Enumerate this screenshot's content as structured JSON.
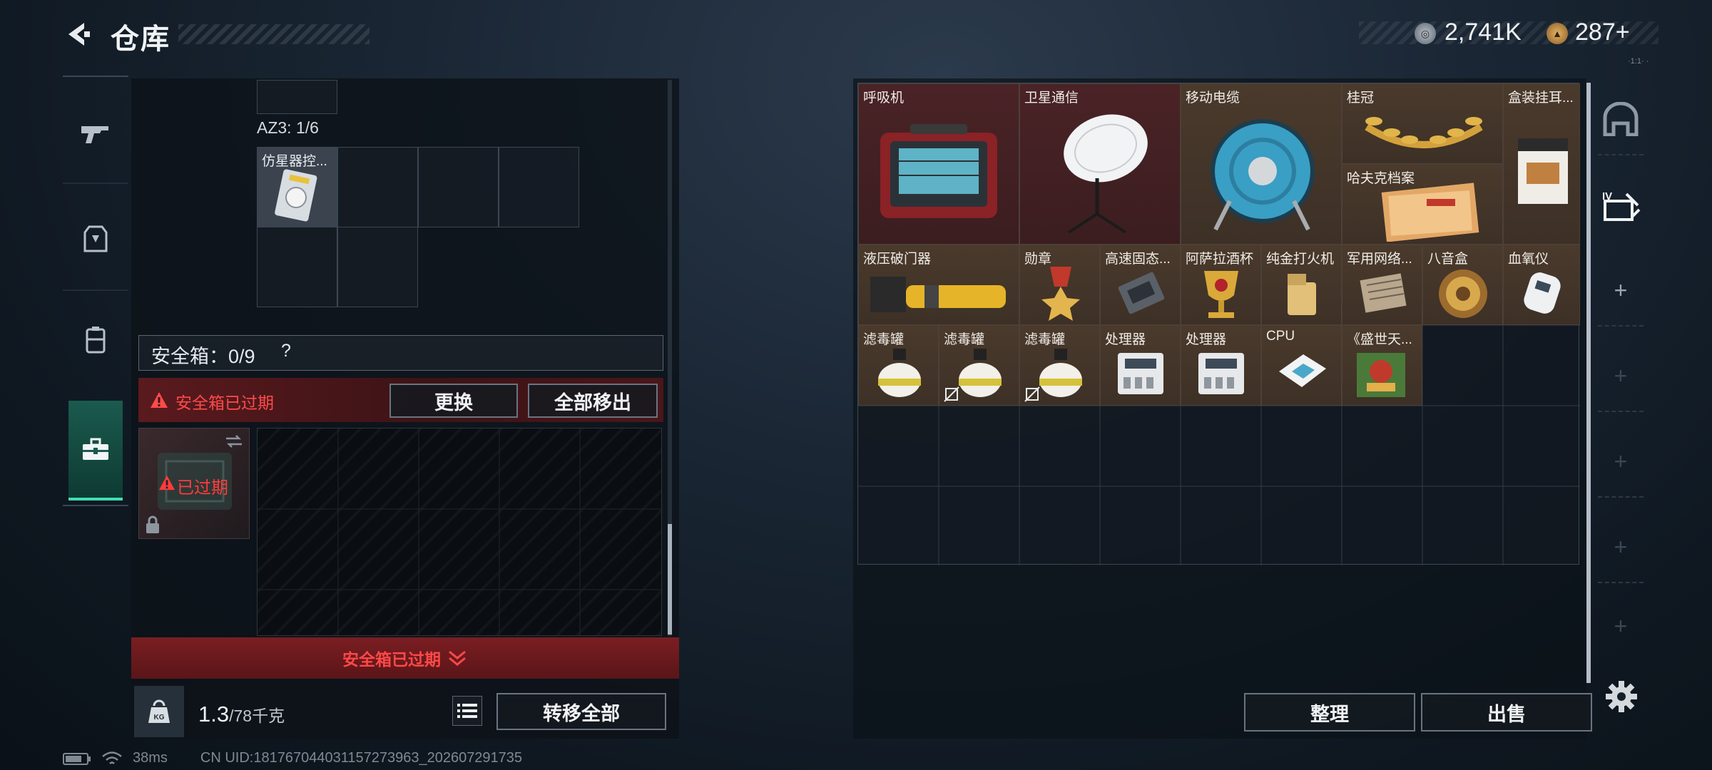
{
  "header": {
    "title": "仓库"
  },
  "currency": {
    "silver": "2,741K",
    "gold": "287+",
    "version": "·1:1· ·"
  },
  "left": {
    "az3_label": "AZ3: 1/6",
    "az3_item": "仿星器控...",
    "safebox_label": "安全箱：0/9",
    "safebox_help": "?",
    "expired_message": "安全箱已过期",
    "replace_btn": "更换",
    "move_all_out_btn": "全部移出",
    "safebox_status": "已过期",
    "collapse_text": "安全箱已过期",
    "weight_current": "1.3",
    "weight_max": "/78千克",
    "weight_icon_text": "KG",
    "transfer_all_btn": "转移全部"
  },
  "status": {
    "ping": "38ms",
    "uid": "CN UID:181767044031157273963_202607291735"
  },
  "items": [
    {
      "name": "呼吸机"
    },
    {
      "name": "卫星通信"
    },
    {
      "name": "移动电缆"
    },
    {
      "name": "桂冠"
    },
    {
      "name": "盒装挂耳..."
    },
    {
      "name": "哈夫克档案"
    },
    {
      "name": "液压破门器"
    },
    {
      "name": "勋章"
    },
    {
      "name": "高速固态..."
    },
    {
      "name": "阿萨拉酒杯"
    },
    {
      "name": "纯金打火机"
    },
    {
      "name": "军用网络..."
    },
    {
      "name": "八音盒"
    },
    {
      "name": "血氧仪"
    },
    {
      "name": "滤毒罐"
    },
    {
      "name": "滤毒罐"
    },
    {
      "name": "滤毒罐"
    },
    {
      "name": "处理器"
    },
    {
      "name": "处理器"
    },
    {
      "name": "CPU"
    },
    {
      "name": "《盛世天..."
    }
  ],
  "actions": {
    "sort": "整理",
    "sell": "出售"
  },
  "colors": {
    "accent_teal": "#3ee0b2",
    "alert_red": "#ff4a4a",
    "item_red_bg": "#4a2326",
    "item_brown_bg": "#4a3a2c"
  }
}
